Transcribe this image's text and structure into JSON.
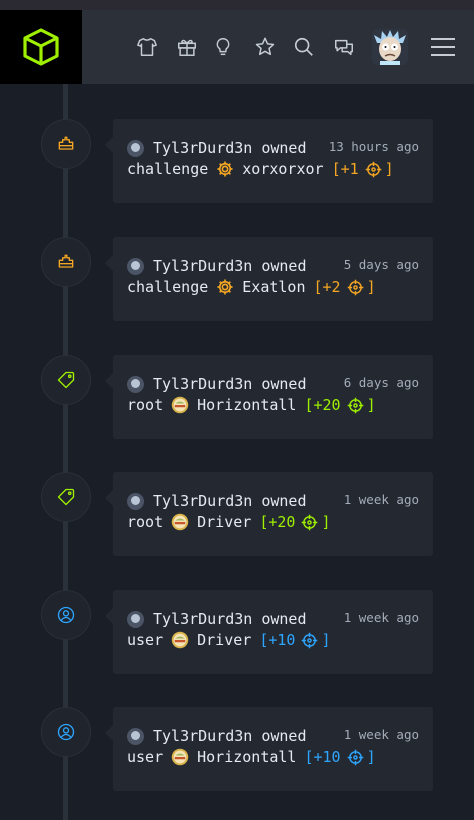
{
  "header": {
    "nav_icons": [
      "shirt-icon",
      "gift-icon",
      "lightbulb-icon",
      "star-icon",
      "search-icon",
      "chat-icon"
    ],
    "brand_color": "#9fef00"
  },
  "colors": {
    "challenge": "#f5a623",
    "root": "#9fef00",
    "user": "#2ea6ff"
  },
  "timeline": [
    {
      "user": "Tyl3rDurd3n",
      "action": "owned",
      "time": "13 hours ago",
      "type": "challenge",
      "target": "xorxorxor",
      "points": "[+1",
      "close": "]"
    },
    {
      "user": "Tyl3rDurd3n",
      "action": "owned",
      "time": "5 days ago",
      "type": "challenge",
      "target": "Exatlon",
      "points": "[+2",
      "close": "]"
    },
    {
      "user": "Tyl3rDurd3n",
      "action": "owned",
      "time": "6 days ago",
      "type": "root",
      "target": "Horizontall",
      "points": "[+20",
      "close": "]"
    },
    {
      "user": "Tyl3rDurd3n",
      "action": "owned",
      "time": "1 week ago",
      "type": "root",
      "target": "Driver",
      "points": "[+20",
      "close": "]"
    },
    {
      "user": "Tyl3rDurd3n",
      "action": "owned",
      "time": "1 week ago",
      "type": "user",
      "target": "Driver",
      "points": "[+10",
      "close": "]"
    },
    {
      "user": "Tyl3rDurd3n",
      "action": "owned",
      "time": "1 week ago",
      "type": "user",
      "target": "Horizontall",
      "points": "[+10",
      "close": "]"
    }
  ]
}
